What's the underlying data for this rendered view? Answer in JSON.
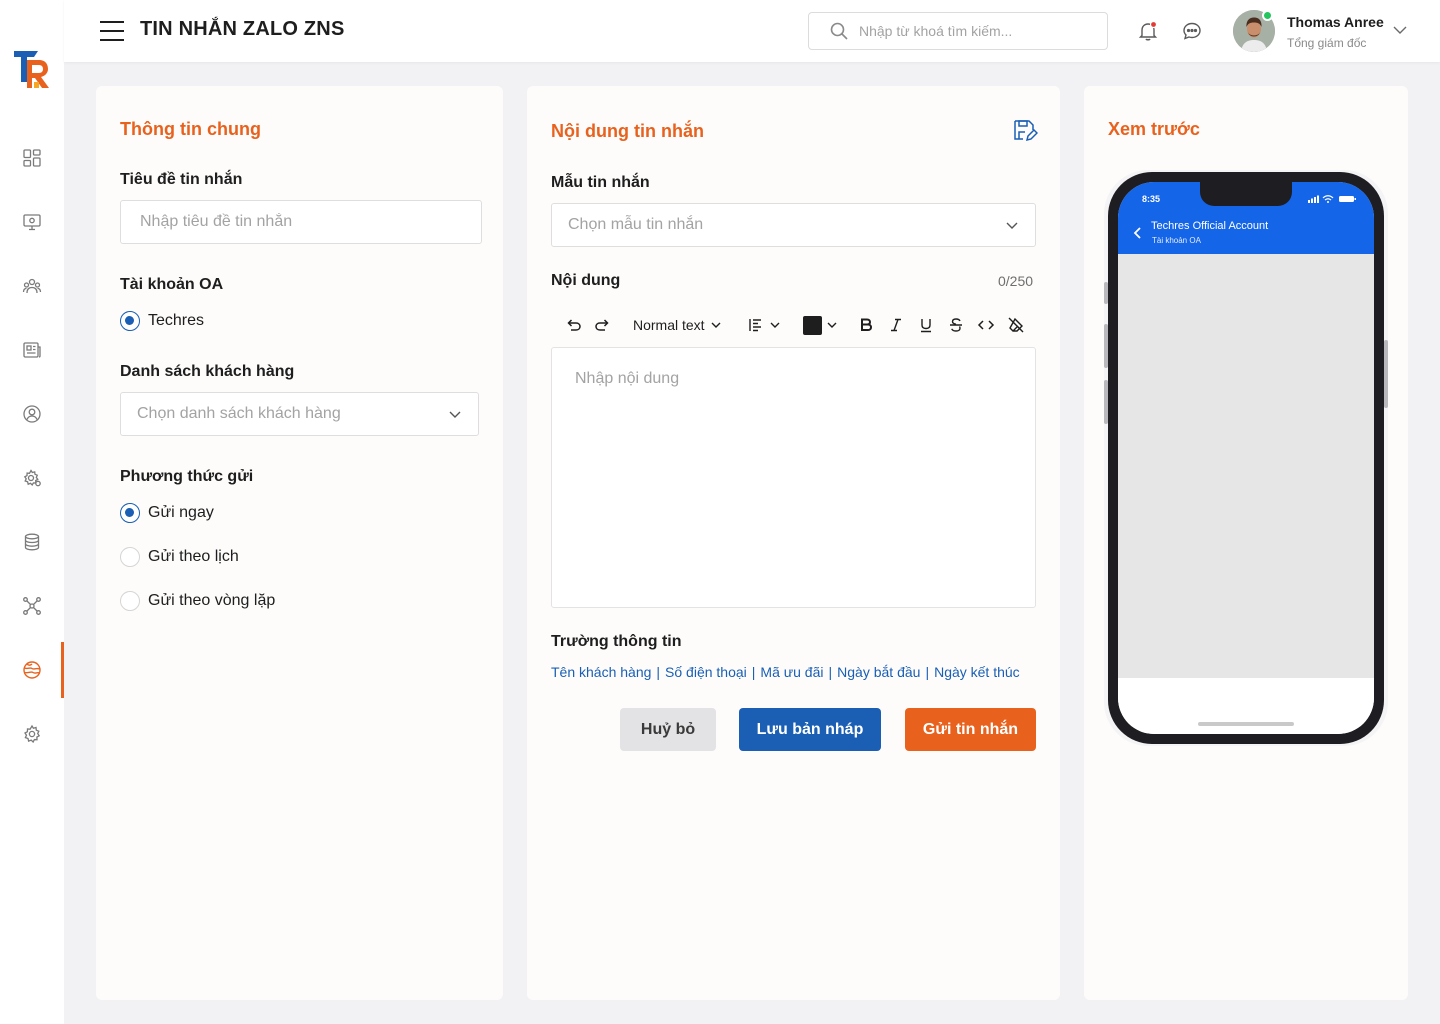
{
  "header": {
    "title": "TIN NHẮN ZALO ZNS",
    "search_placeholder": "Nhập từ khoá tìm kiếm...",
    "user": {
      "name": "Thomas Anree",
      "role": "Tổng giám đốc"
    }
  },
  "sidebar": {
    "items": [
      {
        "icon": "dashboard-icon"
      },
      {
        "icon": "monitor-icon"
      },
      {
        "icon": "team-icon"
      },
      {
        "icon": "news-icon"
      },
      {
        "icon": "user-circle-icon"
      },
      {
        "icon": "settings-gear-icon"
      },
      {
        "icon": "database-icon"
      },
      {
        "icon": "network-icon"
      },
      {
        "icon": "marketing-icon",
        "active": true
      },
      {
        "icon": "settings-icon"
      }
    ],
    "accent_color": "#E8621E"
  },
  "general": {
    "title": "Thông tin chung",
    "subject_label": "Tiêu đề tin nhắn",
    "subject_placeholder": "Nhập tiêu đề tin nhắn",
    "oa_label": "Tài khoản OA",
    "oa_option": "Techres",
    "customers_label": "Danh sách khách hàng",
    "customers_placeholder": "Chọn danh sách khách hàng",
    "method_label": "Phương thức gửi",
    "methods": [
      {
        "label": "Gửi ngay",
        "checked": true
      },
      {
        "label": "Gửi theo lịch",
        "checked": false
      },
      {
        "label": "Gửi theo vòng lặp",
        "checked": false
      }
    ]
  },
  "content": {
    "title": "Nội dung tin nhắn",
    "template_label": "Mẫu tin nhắn",
    "template_placeholder": "Chọn mẫu tin nhắn",
    "body_label": "Nội dung",
    "counter": "0/250",
    "toolbar": {
      "text_style": "Normal text",
      "text_color": "#1E1E1E"
    },
    "body_placeholder": "Nhập nội dung",
    "fields_label": "Trường thông tin",
    "fields": [
      "Tên khách hàng",
      "Số điện thoại",
      "Mã ưu đãi",
      "Ngày bắt đầu",
      "Ngày kết thúc"
    ],
    "buttons": {
      "cancel": "Huỷ bỏ",
      "draft": "Lưu bản nháp",
      "send": "Gửi tin nhắn"
    }
  },
  "preview": {
    "title": "Xem trước",
    "phone": {
      "time": "8:35",
      "account": "Techres Official Account",
      "subtitle": "Tài khoản OA"
    }
  },
  "colors": {
    "accent": "#E8621E",
    "primary": "#1A5FB4",
    "phone_header": "#1565E8"
  }
}
